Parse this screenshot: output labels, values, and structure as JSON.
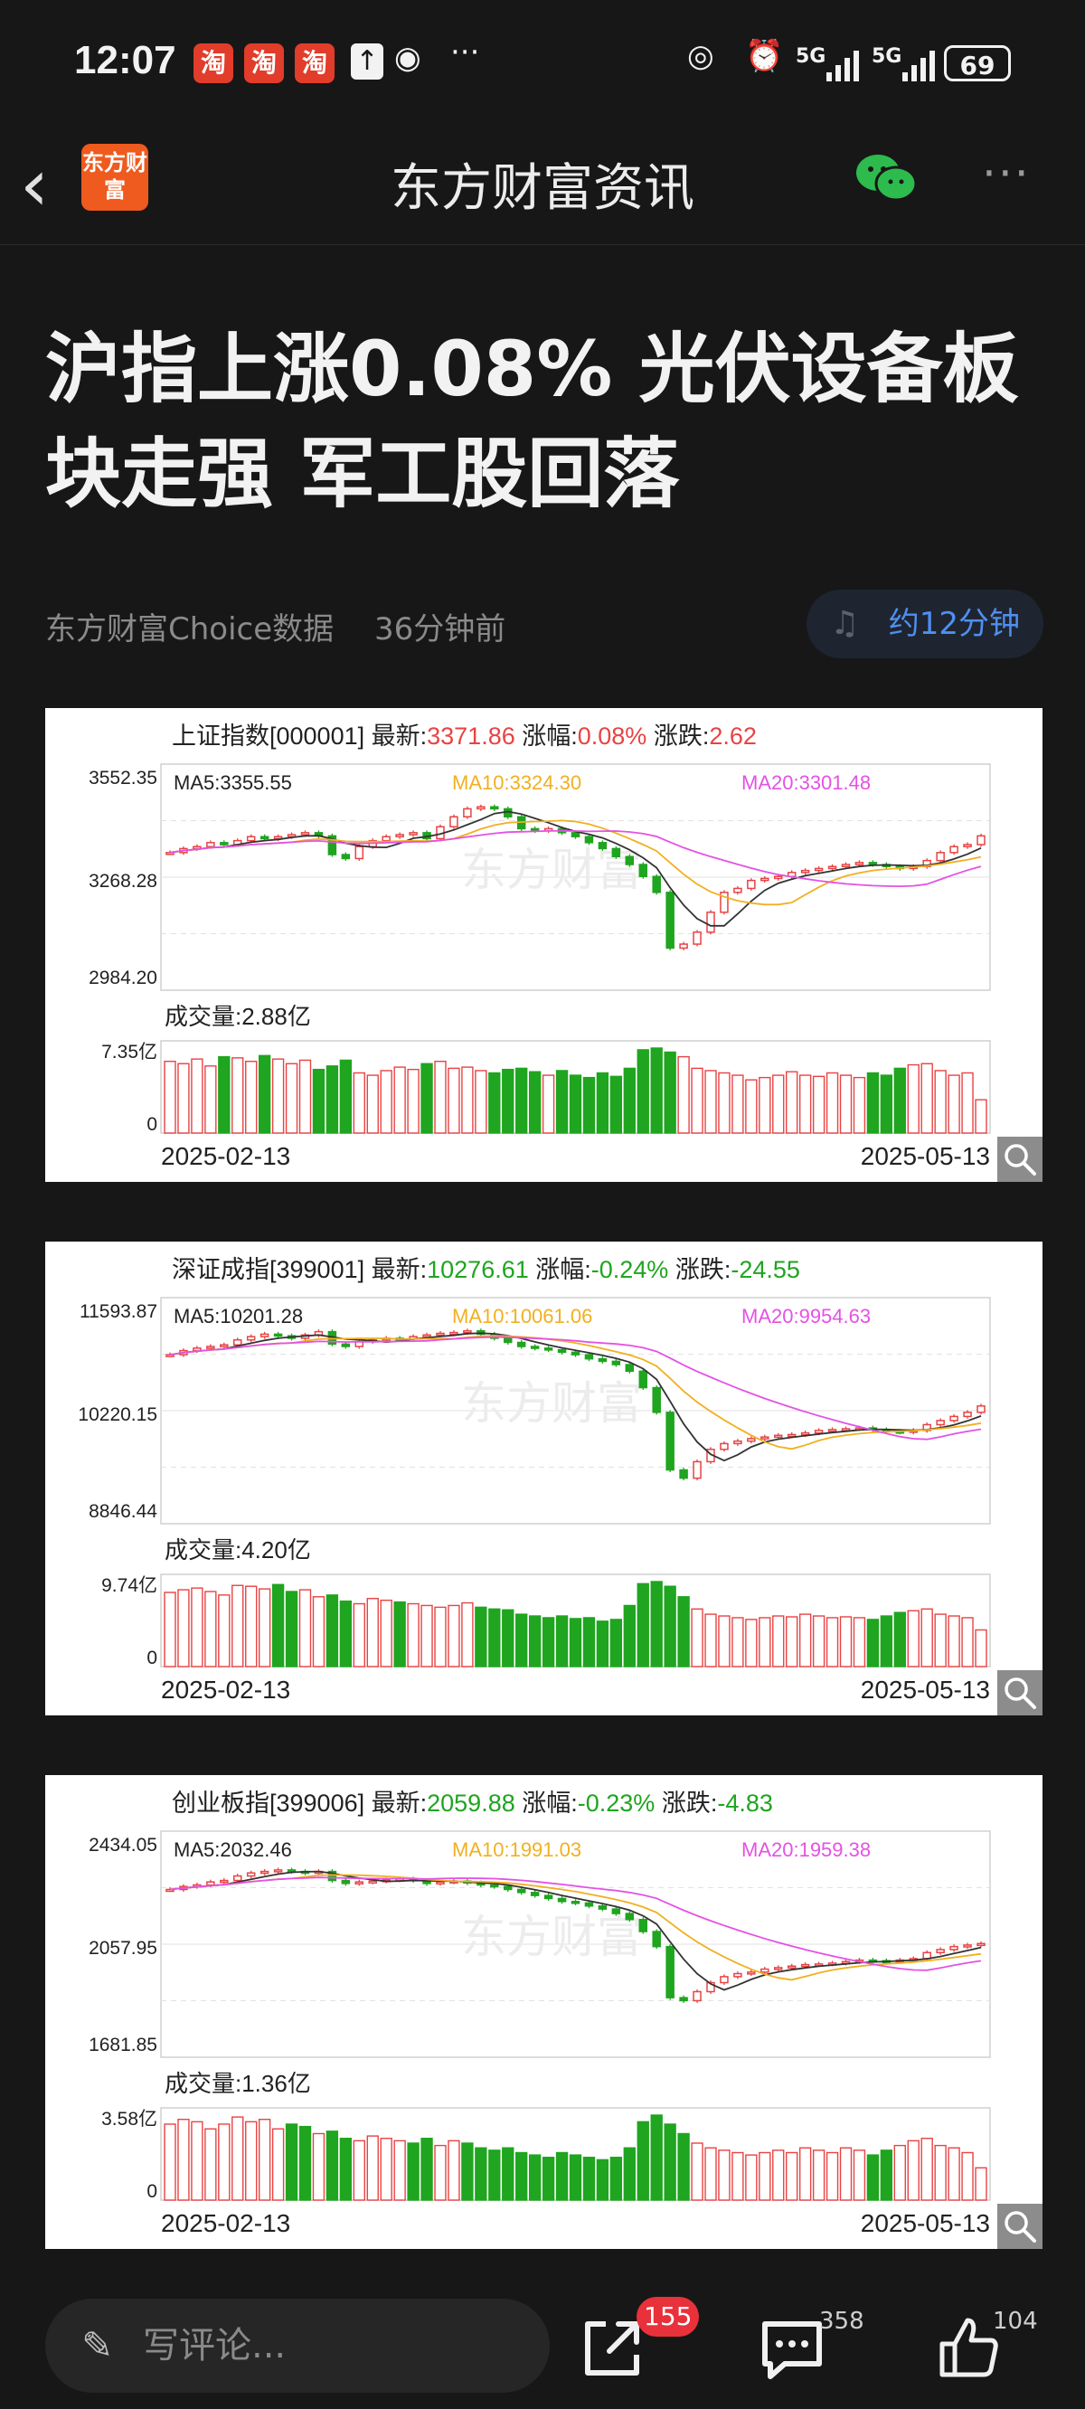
{
  "status_bar": {
    "time": "12:07",
    "app_icons": [
      "淘",
      "淘",
      "淘"
    ],
    "network1": "5G",
    "network2": "5G",
    "battery": "69"
  },
  "nav": {
    "logo_text": "东方财富",
    "title": "东方财富资讯"
  },
  "article": {
    "headline": "沪指上涨0.08% 光伏设备板块走强 军工股回落",
    "source": "东方财富Choice数据",
    "time_ago": "36分钟前",
    "listen_label": "约12分钟"
  },
  "charts": [
    {
      "name_label": "上证指数[000001]",
      "latest_label": "最新:",
      "latest": "3371.86",
      "pct_label": "涨幅:",
      "pct": "0.08%",
      "chg_label": "涨跌:",
      "chg": "2.62",
      "trend": "up",
      "y_ticks": [
        "3552.35",
        "3268.28",
        "2984.20"
      ],
      "ma5": "MA5:3355.55",
      "ma10": "MA10:3324.30",
      "ma20": "MA20:3301.48",
      "volume_label": "成交量:2.88亿",
      "vol_max": "7.35亿",
      "vol_zero": "0",
      "date_start": "2025-02-13",
      "date_end": "2025-05-13",
      "watermark": "东方财富"
    },
    {
      "name_label": "深证成指[399001]",
      "latest_label": "最新:",
      "latest": "10276.61",
      "pct_label": "涨幅:",
      "pct": "-0.24%",
      "chg_label": "涨跌:",
      "chg": "-24.55",
      "trend": "down",
      "y_ticks": [
        "11593.87",
        "10220.15",
        "8846.44"
      ],
      "ma5": "MA5:10201.28",
      "ma10": "MA10:10061.06",
      "ma20": "MA20:9954.63",
      "volume_label": "成交量:4.20亿",
      "vol_max": "9.74亿",
      "vol_zero": "0",
      "date_start": "2025-02-13",
      "date_end": "2025-05-13",
      "watermark": "东方财富"
    },
    {
      "name_label": "创业板指[399006]",
      "latest_label": "最新:",
      "latest": "2059.88",
      "pct_label": "涨幅:",
      "pct": "-0.23%",
      "chg_label": "涨跌:",
      "chg": "-4.83",
      "trend": "down",
      "y_ticks": [
        "2434.05",
        "2057.95",
        "1681.85"
      ],
      "ma5": "MA5:2032.46",
      "ma10": "MA10:1991.03",
      "ma20": "MA20:1959.38",
      "volume_label": "成交量:1.36亿",
      "vol_max": "3.58亿",
      "vol_zero": "0",
      "date_start": "2025-02-13",
      "date_end": "2025-05-13",
      "watermark": "东方财富"
    }
  ],
  "chart_data": [
    {
      "type": "candlestick",
      "title": "上证指数[000001]",
      "x_range": [
        "2025-02-13",
        "2025-05-13"
      ],
      "ylim": [
        2984.2,
        3552.35
      ],
      "close_series": [
        3330,
        3340,
        3345,
        3355,
        3350,
        3360,
        3370,
        3365,
        3370,
        3375,
        3380,
        3372,
        3325,
        3315,
        3345,
        3360,
        3370,
        3375,
        3380,
        3365,
        3395,
        3420,
        3440,
        3445,
        3440,
        3420,
        3390,
        3385,
        3390,
        3380,
        3370,
        3355,
        3340,
        3320,
        3300,
        3270,
        3230,
        3090,
        3100,
        3130,
        3180,
        3230,
        3240,
        3260,
        3265,
        3270,
        3280,
        3285,
        3290,
        3295,
        3300,
        3305,
        3300,
        3295,
        3290,
        3295,
        3310,
        3330,
        3345,
        3350,
        3372
      ],
      "volume_max": 7.35,
      "volume_series": [
        6.2,
        6.0,
        6.4,
        5.8,
        6.6,
        6.5,
        6.2,
        6.7,
        6.4,
        6.0,
        6.3,
        5.5,
        5.8,
        6.3,
        5.2,
        5.0,
        5.4,
        5.7,
        5.5,
        6.0,
        6.2,
        5.6,
        5.7,
        5.4,
        5.2,
        5.5,
        5.6,
        5.3,
        5.0,
        5.4,
        5.0,
        4.8,
        5.2,
        4.9,
        5.6,
        7.2,
        7.35,
        7.0,
        6.6,
        5.6,
        5.4,
        5.2,
        5.0,
        4.6,
        4.8,
        5.0,
        5.3,
        5.0,
        4.9,
        5.2,
        5.0,
        4.8,
        5.2,
        5.0,
        5.6,
        5.9,
        6.0,
        5.4,
        5.0,
        5.2,
        2.88
      ]
    },
    {
      "type": "candlestick",
      "title": "深证成指[399001]",
      "x_range": [
        "2025-02-13",
        "2025-05-13"
      ],
      "ylim": [
        8846.44,
        11593.87
      ],
      "close_series": [
        10900,
        10950,
        10980,
        11000,
        11020,
        11080,
        11120,
        11150,
        11130,
        11100,
        11140,
        11180,
        11030,
        11000,
        11060,
        11080,
        11100,
        11090,
        11120,
        11140,
        11160,
        11170,
        11190,
        11150,
        11100,
        11050,
        11000,
        10980,
        10960,
        10930,
        10900,
        10850,
        10820,
        10780,
        10700,
        10500,
        10200,
        9500,
        9400,
        9600,
        9750,
        9820,
        9850,
        9880,
        9900,
        9920,
        9930,
        9950,
        9980,
        9990,
        10000,
        10010,
        9990,
        9970,
        9960,
        9980,
        10050,
        10100,
        10150,
        10200,
        10277
      ],
      "volume_max": 9.74,
      "volume_series": [
        8.5,
        8.8,
        9.0,
        8.6,
        8.2,
        9.3,
        9.2,
        8.9,
        9.4,
        8.6,
        8.8,
        8.0,
        8.2,
        7.5,
        7.2,
        7.8,
        7.6,
        7.4,
        7.2,
        7.0,
        6.8,
        7.0,
        7.3,
        6.8,
        6.6,
        6.5,
        6.0,
        5.8,
        5.6,
        5.8,
        5.5,
        5.6,
        5.2,
        5.4,
        7.0,
        9.5,
        9.74,
        9.2,
        8.0,
        6.6,
        6.0,
        5.8,
        5.6,
        5.4,
        5.6,
        5.8,
        5.7,
        6.0,
        5.8,
        5.6,
        5.7,
        5.6,
        5.4,
        5.8,
        6.2,
        6.4,
        6.6,
        6.0,
        5.8,
        5.6,
        4.2
      ]
    },
    {
      "type": "candlestick",
      "title": "创业板指[399006]",
      "x_range": [
        "2025-02-13",
        "2025-05-13"
      ],
      "ylim": [
        1681.85,
        2434.05
      ],
      "close_series": [
        2240,
        2250,
        2255,
        2265,
        2270,
        2285,
        2295,
        2300,
        2305,
        2300,
        2295,
        2300,
        2270,
        2260,
        2265,
        2268,
        2272,
        2275,
        2270,
        2260,
        2265,
        2268,
        2262,
        2255,
        2250,
        2240,
        2230,
        2220,
        2210,
        2200,
        2195,
        2185,
        2175,
        2160,
        2140,
        2100,
        2050,
        1880,
        1870,
        1900,
        1930,
        1950,
        1960,
        1965,
        1975,
        1980,
        1985,
        1990,
        1992,
        1995,
        2000,
        2005,
        2003,
        2000,
        2005,
        2010,
        2030,
        2040,
        2050,
        2055,
        2060
      ],
      "volume_max": 3.58,
      "volume_series": [
        3.2,
        3.4,
        3.3,
        3.0,
        3.2,
        3.5,
        3.3,
        3.4,
        3.0,
        3.2,
        3.1,
        2.8,
        2.9,
        2.6,
        2.5,
        2.7,
        2.6,
        2.5,
        2.4,
        2.6,
        2.3,
        2.5,
        2.4,
        2.2,
        2.1,
        2.2,
        2.0,
        1.9,
        1.8,
        2.0,
        1.9,
        1.8,
        1.7,
        1.8,
        2.2,
        3.3,
        3.58,
        3.2,
        2.8,
        2.4,
        2.2,
        2.1,
        2.0,
        1.9,
        2.0,
        2.1,
        2.0,
        2.2,
        2.1,
        2.0,
        2.2,
        2.1,
        1.9,
        2.1,
        2.3,
        2.5,
        2.6,
        2.3,
        2.2,
        2.0,
        1.36
      ]
    }
  ],
  "bottom_bar": {
    "comment_placeholder": "写评论...",
    "share_badge": "155",
    "comments_count": "358",
    "likes_count": "104"
  },
  "colors": {
    "up": "#e84343",
    "down": "#1fa51f",
    "ma10": "#f0b020",
    "ma20": "#e452e4",
    "accent_blue": "#4f8ff0"
  }
}
